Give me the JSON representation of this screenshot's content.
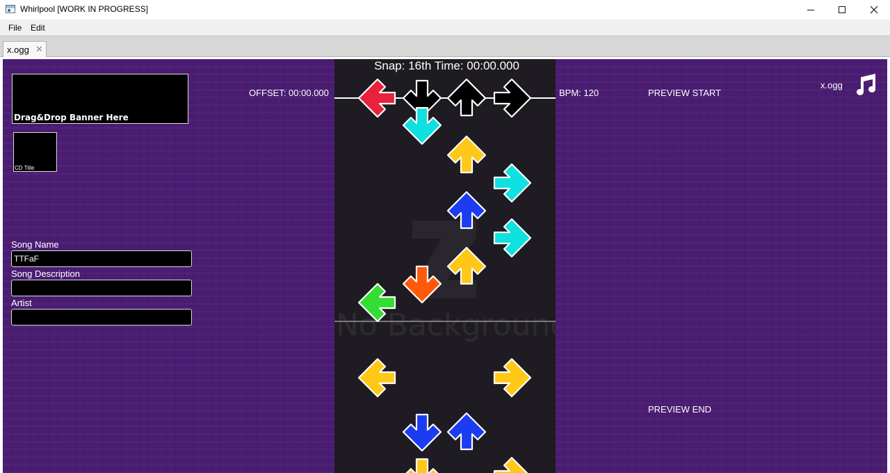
{
  "window": {
    "title": "Whirlpool [WORK IN PROGRESS]",
    "app_icon": "window-app-icon",
    "controls": [
      "minimize-icon",
      "maximize-icon",
      "close-icon"
    ]
  },
  "menu": {
    "file": "File",
    "edit": "Edit"
  },
  "tabs": [
    {
      "label": "x.ogg",
      "close_glyph": "✕"
    }
  ],
  "left_panel": {
    "banner_label": "Drag&Drop Banner Here",
    "cdtitle_label": "CD Title",
    "fields": [
      {
        "label": "Song Name",
        "value": "TTFaF"
      },
      {
        "label": "Song Description",
        "value": ""
      },
      {
        "label": "Artist",
        "value": ""
      }
    ]
  },
  "editor": {
    "snap_text": "Snap: 16th  Time: 00:00.000",
    "offset_text": "OFFSET: 00:00.000",
    "bpm_text": "BPM: 120",
    "preview_start": "PREVIEW START",
    "preview_end": "PREVIEW END",
    "audio_name": "x.ogg",
    "no_background_text": "No Background",
    "music_icon": "music-note-icon",
    "receptors": [
      "left",
      "down",
      "up",
      "right"
    ],
    "note_colors": {
      "red": "#e8213d",
      "cyan": "#0fe0e0",
      "yellow": "#ffc817",
      "blue": "#1c3cf2",
      "orange": "#ff5a0a",
      "green": "#33dd33",
      "receptor": "#000000"
    },
    "notes": [
      {
        "lane": "down",
        "color": "cyan"
      },
      {
        "lane": "up",
        "color": "yellow"
      },
      {
        "lane": "right",
        "color": "cyan"
      },
      {
        "lane": "up",
        "color": "blue"
      },
      {
        "lane": "right",
        "color": "cyan"
      },
      {
        "lane": "up",
        "color": "yellow"
      },
      {
        "lane": "down",
        "color": "orange"
      },
      {
        "lane": "left",
        "color": "green"
      },
      {
        "lane": "left",
        "color": "yellow"
      },
      {
        "lane": "right",
        "color": "yellow"
      },
      {
        "lane": "down",
        "color": "blue"
      },
      {
        "lane": "up",
        "color": "blue"
      },
      {
        "lane": "down",
        "color": "yellow"
      },
      {
        "lane": "right",
        "color": "yellow"
      }
    ]
  }
}
